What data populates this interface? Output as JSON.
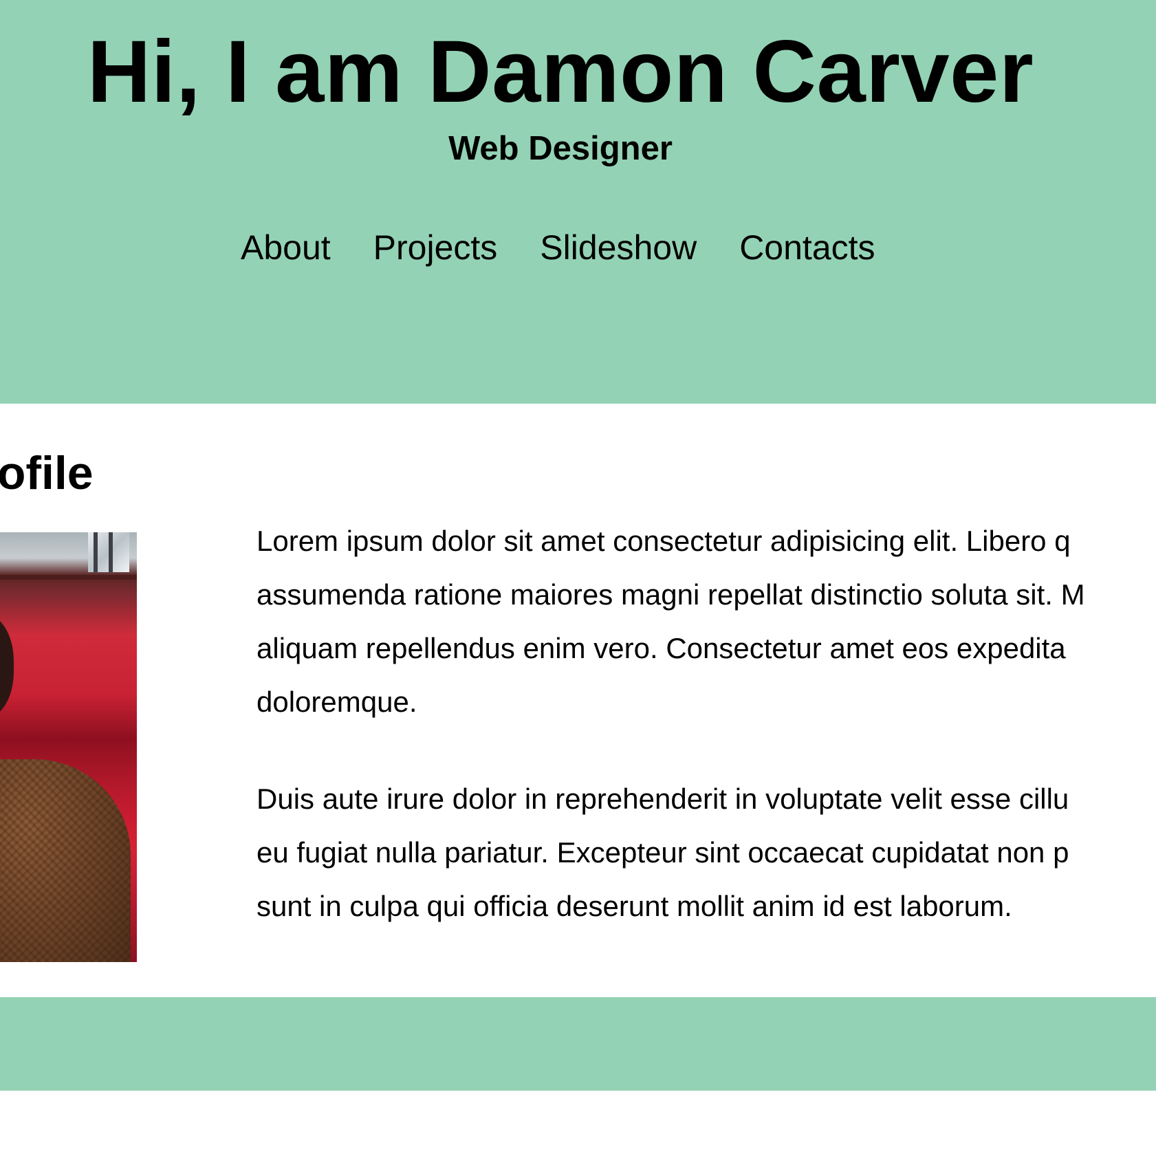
{
  "header": {
    "title": "Hi, I am Damon Carver",
    "subtitle": "Web Designer",
    "nav": [
      {
        "label": "About"
      },
      {
        "label": "Projects"
      },
      {
        "label": "Slideshow"
      },
      {
        "label": "Contacts"
      }
    ]
  },
  "about": {
    "heading": "Profile",
    "paragraphs": [
      [
        "Lorem ipsum dolor sit amet consectetur adipisicing elit. Libero q",
        "assumenda ratione maiores magni repellat distinctio soluta sit. M",
        "aliquam repellendus enim vero. Consectetur amet eos expedita",
        "doloremque."
      ],
      [
        "Duis aute irure dolor in reprehenderit in voluptate velit esse cillu",
        "eu fugiat nulla pariatur. Excepteur sint occaecat cupidatat non p",
        "sunt in culpa qui officia deserunt mollit anim id est laborum."
      ]
    ]
  },
  "colors": {
    "accent_green": "#94d2b5",
    "background": "#ffffff",
    "text": "#000000"
  }
}
